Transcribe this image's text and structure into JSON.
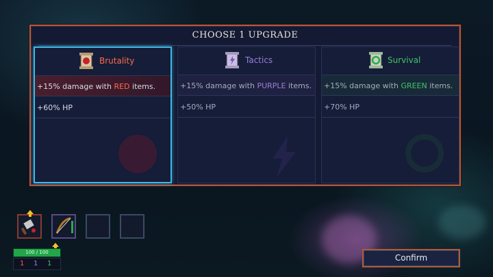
{
  "dialog": {
    "title": "CHOOSE 1 UPGRADE"
  },
  "cards": [
    {
      "name": "Brutality",
      "icon": "brutality-scroll-icon",
      "color": "#ff6a4d",
      "selected": true,
      "effect1_prefix": "+15% damage with ",
      "effect1_keyword": "RED",
      "effect1_suffix": " items.",
      "effect2": "+60% HP"
    },
    {
      "name": "Tactics",
      "icon": "tactics-scroll-icon",
      "color": "#9a7fd8",
      "selected": false,
      "effect1_prefix": "+15% damage with ",
      "effect1_keyword": "PURPLE",
      "effect1_suffix": " items.",
      "effect2": "+50% HP"
    },
    {
      "name": "Survival",
      "icon": "survival-scroll-icon",
      "color": "#41c46a",
      "selected": false,
      "effect1_prefix": "+15% damage with ",
      "effect1_keyword": "GREEN",
      "effect1_suffix": " items.",
      "effect2": "+70% HP"
    }
  ],
  "inventory": {
    "slots": [
      "weapon-cleaver-icon",
      "weapon-bow-icon",
      "empty-slot",
      "empty-slot"
    ]
  },
  "player": {
    "hp_text": "100 / 100",
    "hp_fraction": 1.0,
    "stats": {
      "red": "1",
      "purple": "1",
      "green": "1"
    }
  },
  "actions": {
    "confirm": "Confirm"
  }
}
